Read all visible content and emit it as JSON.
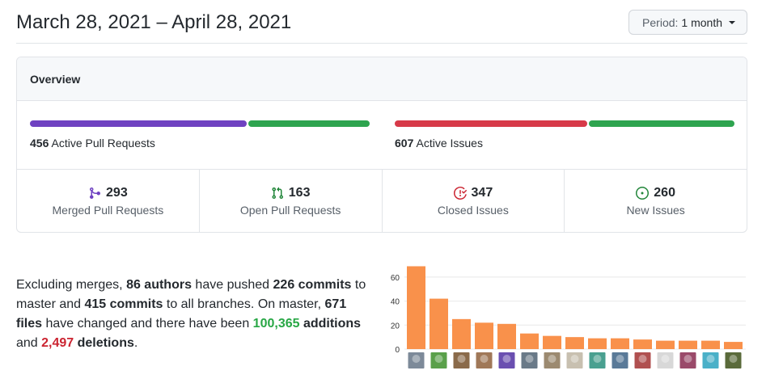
{
  "header": {
    "title": "March 28, 2021 – April 28, 2021",
    "period_label": "Period:",
    "period_value": "1 month"
  },
  "overview": {
    "title": "Overview",
    "pull_requests": {
      "count": "456",
      "label": "Active Pull Requests",
      "merged_fraction": 0.64,
      "colors": [
        "#6f42c1",
        "#2ea44f"
      ]
    },
    "issues": {
      "count": "607",
      "label": "Active Issues",
      "closed_fraction": 0.57,
      "colors": [
        "#d73a49",
        "#2ea44f"
      ]
    },
    "stats": [
      {
        "count": "293",
        "label": "Merged Pull Requests",
        "icon": "git-merge-icon",
        "color": "#6f42c1"
      },
      {
        "count": "163",
        "label": "Open Pull Requests",
        "icon": "git-pull-request-icon",
        "color": "#22863a"
      },
      {
        "count": "347",
        "label": "Closed Issues",
        "icon": "issue-closed-icon",
        "color": "#cb2431"
      },
      {
        "count": "260",
        "label": "New Issues",
        "icon": "issue-opened-icon",
        "color": "#22863a"
      }
    ]
  },
  "summary": {
    "p1": "Excluding merges, ",
    "authors": "86 authors",
    "p2": " have pushed ",
    "commits_master": "226 commits",
    "p3": " to master and ",
    "commits_all": "415 commits",
    "p4": " to all branches. On master, ",
    "files": "671 files",
    "p5": " have changed and there have been ",
    "additions_num": "100,365",
    "additions_word": " additions",
    "p6": " and ",
    "deletions_num": "2,497",
    "deletions_word": " deletions",
    "p7": "."
  },
  "chart_data": {
    "type": "bar",
    "categories": [
      "1",
      "2",
      "3",
      "4",
      "5",
      "6",
      "7",
      "8",
      "9",
      "10",
      "11",
      "12",
      "13",
      "14",
      "15"
    ],
    "values": [
      69,
      42,
      25,
      22,
      21,
      13,
      11,
      10,
      9,
      9,
      8,
      7,
      7,
      7,
      6
    ],
    "ylim": [
      0,
      70
    ],
    "yticks": [
      "0",
      "20",
      "40",
      "60"
    ],
    "bar_color": "#f9914b",
    "grid": true,
    "avatar_colors": [
      "#7d8a99",
      "#5aa04a",
      "#8a6a4a",
      "#a07858",
      "#6a4fb0",
      "#6a7a88",
      "#9c8a70",
      "#c8c0b0",
      "#4aa090",
      "#5a7a98",
      "#b05050",
      "#d8d8d8",
      "#9a4a6a",
      "#4ab0c8",
      "#5a6a3a"
    ]
  }
}
